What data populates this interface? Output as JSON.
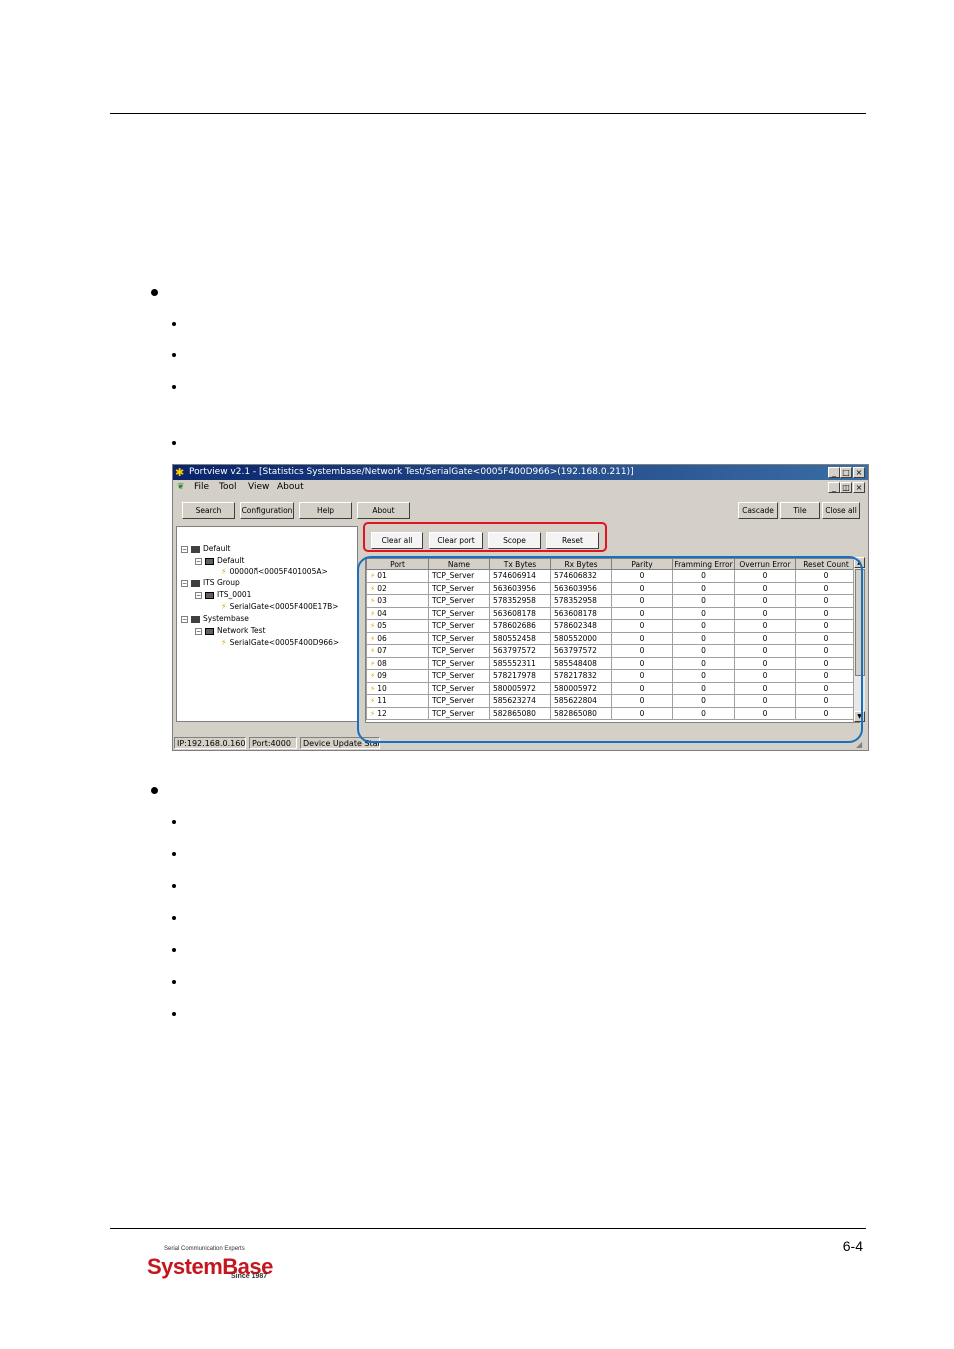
{
  "window": {
    "title": "Portview v2.1 - [Statistics Systembase/Network Test/SerialGate<0005F400D966>(192.168.0.211)]",
    "menu": [
      "File",
      "Tool",
      "View",
      "About"
    ],
    "toolbar_left": [
      "Search",
      "Configuration",
      "Help",
      "About"
    ],
    "toolbar_right": [
      "Cascade",
      "Tile",
      "Close all"
    ],
    "tree": [
      {
        "label": "Default",
        "level": 0,
        "kind": "folder"
      },
      {
        "label": "Default",
        "level": 1,
        "kind": "device"
      },
      {
        "label": "00000กี<0005F401005A>",
        "level": 2,
        "kind": "port"
      },
      {
        "label": "ITS Group",
        "level": 0,
        "kind": "folder"
      },
      {
        "label": "ITS_0001",
        "level": 1,
        "kind": "device"
      },
      {
        "label": "SerialGate<0005F400E17B>",
        "level": 2,
        "kind": "port"
      },
      {
        "label": "Systembase",
        "level": 0,
        "kind": "folder"
      },
      {
        "label": "Network Test",
        "level": 1,
        "kind": "device"
      },
      {
        "label": "SerialGate<0005F400D966>",
        "level": 2,
        "kind": "port-active"
      }
    ],
    "stat_buttons": [
      "Clear all",
      "Clear port",
      "Scope",
      "Reset"
    ],
    "columns": [
      "Port",
      "Name",
      "Tx Bytes",
      "Rx Bytes",
      "Parity",
      "Framming Error",
      "Overrun Error",
      "Reset Count"
    ],
    "rows": [
      [
        "01",
        "TCP_Server",
        "574606914",
        "574606832",
        "0",
        "0",
        "0",
        "0"
      ],
      [
        "02",
        "TCP_Server",
        "563603956",
        "563603956",
        "0",
        "0",
        "0",
        "0"
      ],
      [
        "03",
        "TCP_Server",
        "578352958",
        "578352958",
        "0",
        "0",
        "0",
        "0"
      ],
      [
        "04",
        "TCP_Server",
        "563608178",
        "563608178",
        "0",
        "0",
        "0",
        "0"
      ],
      [
        "05",
        "TCP_Server",
        "578602686",
        "578602348",
        "0",
        "0",
        "0",
        "0"
      ],
      [
        "06",
        "TCP_Server",
        "580552458",
        "580552000",
        "0",
        "0",
        "0",
        "0"
      ],
      [
        "07",
        "TCP_Server",
        "563797572",
        "563797572",
        "0",
        "0",
        "0",
        "0"
      ],
      [
        "08",
        "TCP_Server",
        "585552311",
        "585548408",
        "0",
        "0",
        "0",
        "0"
      ],
      [
        "09",
        "TCP_Server",
        "578217978",
        "578217832",
        "0",
        "0",
        "0",
        "0"
      ],
      [
        "10",
        "TCP_Server",
        "580005972",
        "580005972",
        "0",
        "0",
        "0",
        "0"
      ],
      [
        "11",
        "TCP_Server",
        "585623274",
        "585622804",
        "0",
        "0",
        "0",
        "0"
      ],
      [
        "12",
        "TCP_Server",
        "582865080",
        "582865080",
        "0",
        "0",
        "0",
        "0"
      ]
    ],
    "status": [
      "IP:192.168.0.160",
      "Port:4000",
      "Device Update Start"
    ]
  },
  "footer": {
    "page_number": "6-4",
    "logo_tagline": "Serial Communication Experts",
    "logo_name": "SystemBase",
    "logo_since": "Since 1987"
  }
}
